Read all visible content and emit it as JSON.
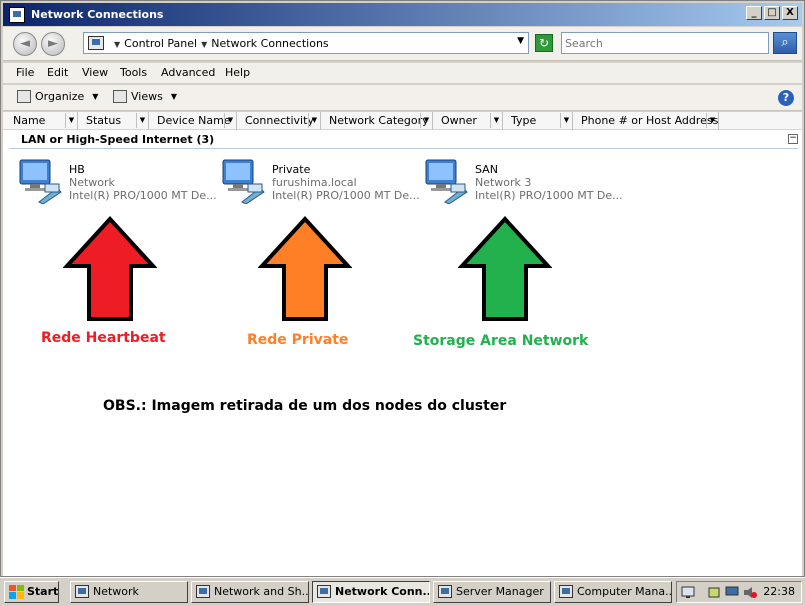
{
  "window": {
    "title": "Network Connections",
    "controls": [
      "_",
      "□",
      "X"
    ]
  },
  "address": {
    "crumbs": [
      "Control Panel",
      "Network Connections"
    ],
    "search_placeholder": "Search"
  },
  "menu": [
    "File",
    "Edit",
    "View",
    "Tools",
    "Advanced",
    "Help"
  ],
  "toolbar": {
    "organize": "Organize",
    "views": "Views"
  },
  "columns": [
    "Name",
    "Status",
    "Device Name",
    "Connectivity",
    "Network Category",
    "Owner",
    "Type",
    "Phone # or Host Address"
  ],
  "group": {
    "title": "LAN or High-Speed Internet (3)"
  },
  "connections": [
    {
      "name": "HB",
      "network": "Network",
      "device": "Intel(R) PRO/1000 MT De..."
    },
    {
      "name": "Private",
      "network": "furushima.local",
      "device": "Intel(R) PRO/1000 MT De..."
    },
    {
      "name": "SAN",
      "network": "Network  3",
      "device": "Intel(R) PRO/1000 MT De..."
    }
  ],
  "annotations": [
    {
      "label": "Rede Heartbeat",
      "color": "#ee1c24"
    },
    {
      "label": "Rede Private",
      "color": "#ff7f27"
    },
    {
      "label": "Storage Area Network",
      "color": "#22b14c"
    }
  ],
  "note": "OBS.: Imagem retirada de um dos nodes do cluster",
  "taskbar": {
    "start": "Start",
    "tasks": [
      "Network",
      "Network and Sh...",
      "Network Conn...",
      "Server Manager",
      "Computer Mana..."
    ],
    "active_task": "Network Conn...",
    "clock": "22:38"
  }
}
